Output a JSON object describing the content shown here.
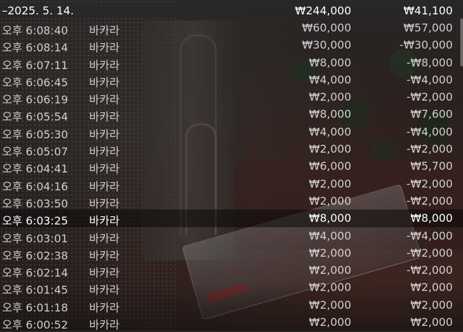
{
  "header": {
    "date": "–2025. 5. 14.",
    "total_bet": "₩244,000",
    "total_result": "₩41,100"
  },
  "rows": [
    {
      "time": "오후 6:08:40",
      "game": "바카라",
      "bet": "₩60,000",
      "result": "₩57,000"
    },
    {
      "time": "오후 6:08:14",
      "game": "바카라",
      "bet": "₩30,000",
      "result": "-₩30,000"
    },
    {
      "time": "오후 6:07:11",
      "game": "바카라",
      "bet": "₩8,000",
      "result": "-₩8,000"
    },
    {
      "time": "오후 6:06:45",
      "game": "바카라",
      "bet": "₩4,000",
      "result": "-₩4,000"
    },
    {
      "time": "오후 6:06:19",
      "game": "바카라",
      "bet": "₩2,000",
      "result": "-₩2,000"
    },
    {
      "time": "오후 6:05:54",
      "game": "바카라",
      "bet": "₩8,000",
      "result": "₩7,600"
    },
    {
      "time": "오후 6:05:30",
      "game": "바카라",
      "bet": "₩4,000",
      "result": "-₩4,000"
    },
    {
      "time": "오후 6:05:07",
      "game": "바카라",
      "bet": "₩2,000",
      "result": "-₩2,000"
    },
    {
      "time": "오후 6:04:41",
      "game": "바카라",
      "bet": "₩6,000",
      "result": "₩5,700"
    },
    {
      "time": "오후 6:04:16",
      "game": "바카라",
      "bet": "₩2,000",
      "result": "-₩2,000"
    },
    {
      "time": "오후 6:03:50",
      "game": "바카라",
      "bet": "₩2,000",
      "result": "-₩2,000"
    },
    {
      "time": "오후 6:03:25",
      "game": "바카라",
      "bet": "₩8,000",
      "result": "₩8,000",
      "highlighted": true
    },
    {
      "time": "오후 6:03:01",
      "game": "바카라",
      "bet": "₩4,000",
      "result": "-₩4,000"
    },
    {
      "time": "오후 6:02:38",
      "game": "바카라",
      "bet": "₩2,000",
      "result": "-₩2,000"
    },
    {
      "time": "오후 6:02:14",
      "game": "바카라",
      "bet": "₩2,000",
      "result": "-₩2,000"
    },
    {
      "time": "오후 6:01:45",
      "game": "바카라",
      "bet": "₩2,000",
      "result": "₩2,000"
    },
    {
      "time": "오후 6:01:18",
      "game": "바카라",
      "bet": "₩2,000",
      "result": "₩2,000"
    },
    {
      "time": "오후 6:00:52",
      "game": "바카라",
      "bet": "₩2,000",
      "result": "₩2,000"
    }
  ],
  "colors": {
    "text_primary": "#ffffff",
    "text_secondary": "#cfcfcf"
  }
}
